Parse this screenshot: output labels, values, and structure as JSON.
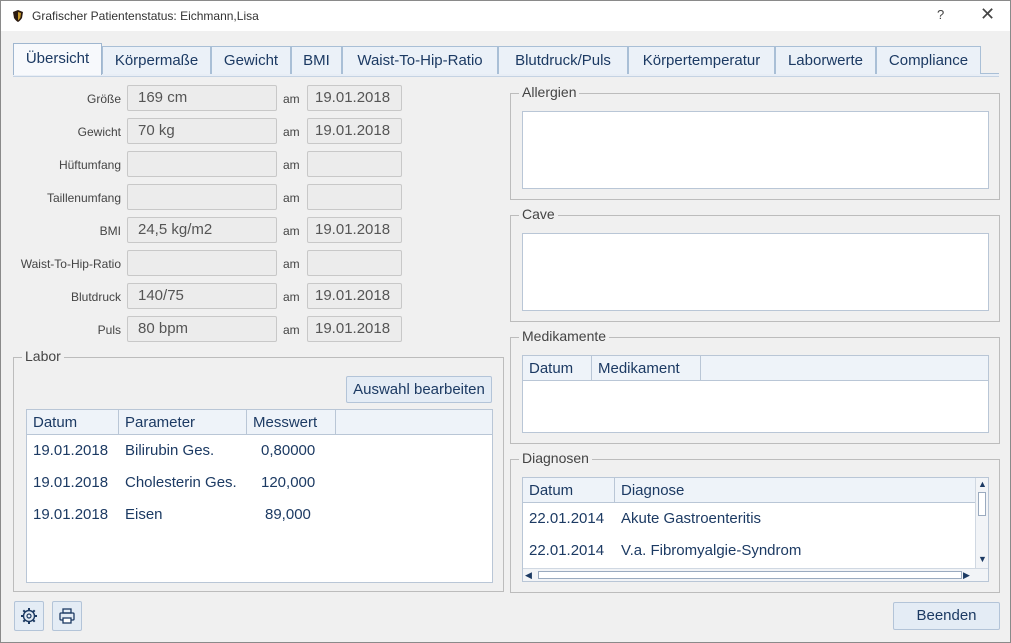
{
  "window": {
    "title": "Grafischer Patientenstatus: Eichmann,Lisa",
    "help": "?",
    "close": "✕"
  },
  "tabs": [
    {
      "label": "Übersicht"
    },
    {
      "label": "Körpermaße"
    },
    {
      "label": "Gewicht"
    },
    {
      "label": "BMI"
    },
    {
      "label": "Waist-To-Hip-Ratio"
    },
    {
      "label": "Blutdruck/Puls"
    },
    {
      "label": "Körpertemperatur"
    },
    {
      "label": "Laborwerte"
    },
    {
      "label": "Compliance"
    }
  ],
  "measures": {
    "am_label": "am",
    "rows": [
      {
        "label": "Größe",
        "value": "169 cm",
        "date": "19.01.2018"
      },
      {
        "label": "Gewicht",
        "value": "70 kg",
        "date": "19.01.2018"
      },
      {
        "label": "Hüftumfang",
        "value": "",
        "date": ""
      },
      {
        "label": "Taillenumfang",
        "value": "",
        "date": ""
      },
      {
        "label": "BMI",
        "value": "24,5 kg/m2",
        "date": "19.01.2018"
      },
      {
        "label": "Waist-To-Hip-Ratio",
        "value": "",
        "date": ""
      },
      {
        "label": "Blutdruck",
        "value": "140/75",
        "date": "19.01.2018"
      },
      {
        "label": "Puls",
        "value": "80 bpm",
        "date": "19.01.2018"
      }
    ]
  },
  "labor": {
    "title": "Labor",
    "edit_button": "Auswahl bearbeiten",
    "columns": [
      "Datum",
      "Parameter",
      "Messwert"
    ],
    "rows": [
      {
        "date": "19.01.2018",
        "param": "Bilirubin Ges.",
        "value": "0,80000"
      },
      {
        "date": "19.01.2018",
        "param": "Cholesterin Ges.",
        "value": "120,000"
      },
      {
        "date": "19.01.2018",
        "param": "Eisen",
        "value": "89,000"
      }
    ]
  },
  "allergien": {
    "title": "Allergien"
  },
  "cave": {
    "title": "Cave"
  },
  "medikamente": {
    "title": "Medikamente",
    "columns": [
      "Datum",
      "Medikament"
    ]
  },
  "diagnosen": {
    "title": "Diagnosen",
    "columns": [
      "Datum",
      "Diagnose"
    ],
    "rows": [
      {
        "date": "22.01.2014",
        "diag": "Akute Gastroenteritis"
      },
      {
        "date": "22.01.2014",
        "diag": "V.a. Fibromyalgie-Syndrom"
      }
    ]
  },
  "footer": {
    "close_button": "Beenden",
    "settings_icon": "gear-icon",
    "print_icon": "printer-icon"
  },
  "colors": {
    "accent_text": "#1c3a63",
    "tab_bg": "#ebf1f8",
    "border": "#a9bfd6"
  }
}
